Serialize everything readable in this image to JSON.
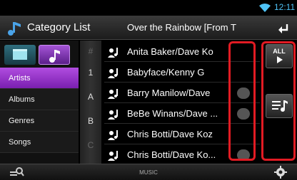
{
  "status": {
    "time": "12:11",
    "wifi_icon": "wifi-icon"
  },
  "header": {
    "title": "Category List",
    "now_playing": "Over the Rainbow [From T",
    "back_icon": "back-icon"
  },
  "modes": {
    "video_icon": "video-icon",
    "music_icon": "music-note-icon"
  },
  "categories": [
    {
      "label": "Artists",
      "selected": true
    },
    {
      "label": "Albums",
      "selected": false
    },
    {
      "label": "Genres",
      "selected": false
    },
    {
      "label": "Songs",
      "selected": false
    }
  ],
  "index": [
    "#",
    "1",
    "A",
    "B",
    "C"
  ],
  "rows": [
    {
      "label": "Anita Baker/Dave Ko",
      "badge": false
    },
    {
      "label": "Babyface/Kenny G",
      "badge": false
    },
    {
      "label": "Barry Manilow/Dave",
      "badge": true
    },
    {
      "label": "BeBe Winans/Dave ...",
      "badge": true
    },
    {
      "label": "Chris Botti/Dave Koz",
      "badge": false
    },
    {
      "label": "Chris Botti/Dave Ko...",
      "badge": true
    }
  ],
  "right_buttons": {
    "all_label": "ALL"
  },
  "footer": {
    "source_label": "MUSIC"
  },
  "colors": {
    "accent": "#a63fd6",
    "highlight": "#e21b23",
    "time": "#4fc3f7"
  }
}
